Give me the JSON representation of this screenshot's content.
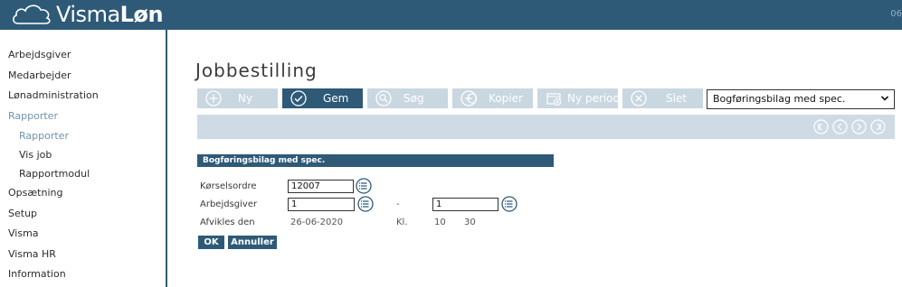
{
  "header": {
    "logo_prefix": "Visma",
    "logo_suffix": "Løn",
    "top_right": "06"
  },
  "sidebar": {
    "items": [
      {
        "label": "Arbejdsgiver"
      },
      {
        "label": "Medarbejder"
      },
      {
        "label": "Lønadministration"
      },
      {
        "label": "Rapporter"
      },
      {
        "label": "Rapporter"
      },
      {
        "label": "Vis job"
      },
      {
        "label": "Rapportmodul"
      },
      {
        "label": "Opsætning"
      },
      {
        "label": "Setup"
      },
      {
        "label": "Visma"
      },
      {
        "label": "Visma HR"
      },
      {
        "label": "Information"
      }
    ]
  },
  "main": {
    "title": "Jobbestilling",
    "toolbar": {
      "new_label": "Ny",
      "save_label": "Gem",
      "search_label": "Søg",
      "copy_label": "Kopier",
      "new_period_label": "Ny periode",
      "delete_label": "Slet"
    },
    "report_select": "Bogføringsbilag med spec.",
    "section_title": "Bogføringsbilag med spec.",
    "form": {
      "order_label": "Kørselsordre",
      "order_value": "12007",
      "employer_label": "Arbejdsgiver",
      "employer_from": "1",
      "range_separator": "-",
      "employer_to": "1",
      "run_label": "Afvikles den",
      "run_date": "26-06-2020",
      "time_label": "Kl.",
      "time_hour": "10",
      "time_minute": "30"
    },
    "ok_label": "OK",
    "cancel_label": "Annuller"
  },
  "colors": {
    "brand": "#2e5a78",
    "toolbar_inactive": "#c9d7e1",
    "bar_gray": "#cfdbe4"
  }
}
